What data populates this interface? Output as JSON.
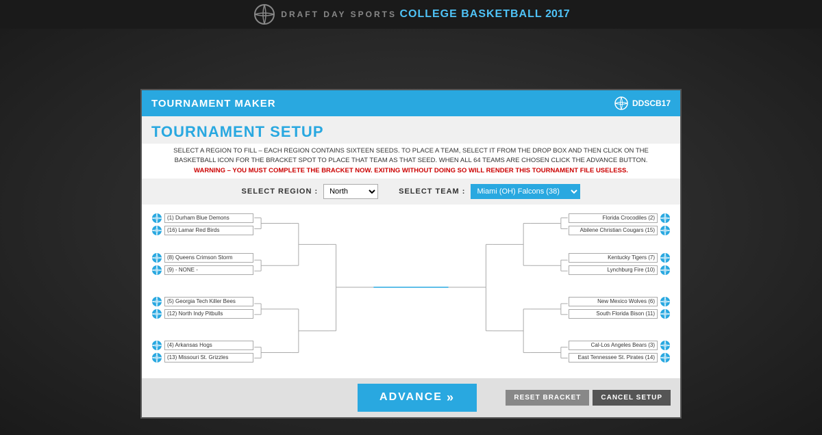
{
  "app": {
    "brand_prefix": "DRAFT DAY SPORTS",
    "brand_main": "COLLEGE BASKETBALL",
    "brand_year": "2017",
    "logo_badge": "DDSCB17"
  },
  "modal": {
    "header_title": "TOURNAMENT MAKER",
    "section_title": "TOURNAMENT SETUP",
    "instructions_line1": "SELECT A REGION TO FILL – EACH REGION CONTAINS SIXTEEN SEEDS. TO PLACE A TEAM, SELECT IT FROM THE DROP BOX AND THEN CLICK ON THE",
    "instructions_line2": "BASKETBALL ICON FOR THE BRACKET SPOT TO PLACE THAT TEAM AS THAT SEED. WHEN ALL 64 TEAMS ARE CHOSEN CLICK THE ADVANCE BUTTON.",
    "warning": "WARNING – YOU MUST COMPLETE THE BRACKET NOW. EXITING WITHOUT DOING SO WILL RENDER THIS TOURNAMENT FILE USELESS.",
    "select_region_label": "SELECT REGION :",
    "select_team_label": "SELECT TEAM :",
    "region_value": "North",
    "team_value": "Miami (OH) Falcons (38)",
    "advance_label": "ADVANCE",
    "reset_label": "RESET BRACKET",
    "cancel_label": "CANCEL SETUP"
  },
  "bracket": {
    "left_teams": [
      {
        "seed": 1,
        "name": "(1)  Durham Blue Demons"
      },
      {
        "seed": 16,
        "name": "(16)  Lamar Red Birds"
      },
      {
        "seed": 8,
        "name": "(8)  Queens Crimson Storm"
      },
      {
        "seed": 9,
        "name": "(9) - NONE -"
      },
      {
        "seed": 5,
        "name": "(5)  Georgia Tech Killer Bees"
      },
      {
        "seed": 12,
        "name": "(12)  North Indy Pitbulls"
      },
      {
        "seed": 4,
        "name": "(4)  Arkansas Hogs"
      },
      {
        "seed": 13,
        "name": "(13)  Missouri St. Grizzles"
      }
    ],
    "right_teams": [
      {
        "seed": 2,
        "name": "Florida Crocodiles  (2)"
      },
      {
        "seed": 15,
        "name": "Abilene Christian Cougars  (15)"
      },
      {
        "seed": 7,
        "name": "Kentucky Tigers  (7)"
      },
      {
        "seed": 10,
        "name": "Lynchburg Fire  (10)"
      },
      {
        "seed": 6,
        "name": "New Mexico Wolves  (6)"
      },
      {
        "seed": 11,
        "name": "South Florida Bison  (11)"
      },
      {
        "seed": 3,
        "name": "Cal-Los Angeles Bears  (3)"
      },
      {
        "seed": 14,
        "name": "East Tennessee St. Pirates  (14)"
      }
    ]
  }
}
